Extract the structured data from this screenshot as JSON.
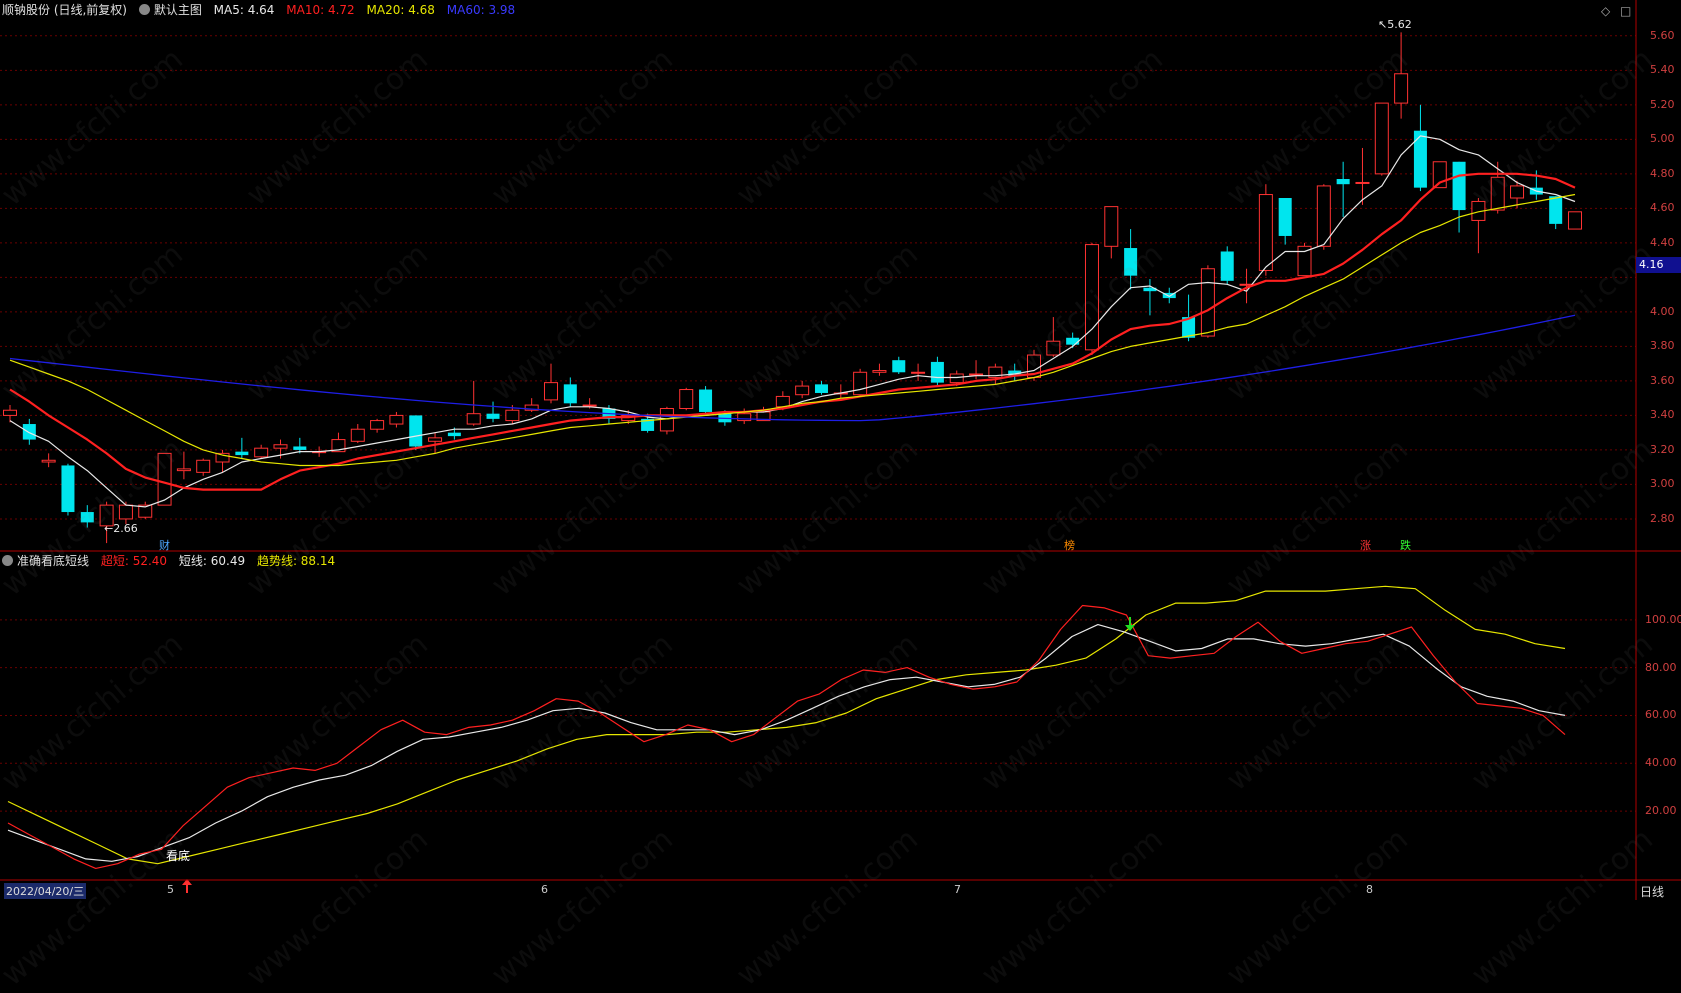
{
  "main_header": {
    "stock_title": "顺钠股份 (日线,前复权)",
    "chart_name": "默认主图",
    "ma5": "MA5: 4.64",
    "ma10": "MA10: 4.72",
    "ma20": "MA20: 4.68",
    "ma60": "MA60: 3.98"
  },
  "sub_header": {
    "indicator_name": "准确看底短线",
    "super_short": "超短: 52.40",
    "short_line": "短线: 60.49",
    "trend_line": "趋势线: 88.14"
  },
  "colors": {
    "up": "#ff3232",
    "down": "#00e5ee",
    "ma5": "#e8e8e8",
    "ma10": "#ff2020",
    "ma20": "#e6e600",
    "ma60": "#1e1ee6",
    "grid": "#6a0000",
    "axis": "#b00000",
    "price_flag": "#101090"
  },
  "price_axis": [
    "5.60",
    "5.40",
    "5.20",
    "5.00",
    "4.80",
    "4.60",
    "4.40",
    "4.00",
    "3.80",
    "3.60",
    "3.40",
    "3.20",
    "3.00",
    "2.80"
  ],
  "current_price": "4.16",
  "indicator_axis": [
    "100.00",
    "80.00",
    "60.00",
    "40.00",
    "20.00"
  ],
  "annotations": {
    "high_label": "5.62",
    "low_label": "←2.66",
    "high_arrow": "↖",
    "bottom_label": "看底"
  },
  "event_markers": [
    {
      "text": "财",
      "color": "#4da6ff"
    },
    {
      "text": "榜",
      "color": "#ff8c00"
    },
    {
      "text": "涨",
      "color": "#ff3232"
    },
    {
      "text": "跌",
      "color": "#33ff33"
    }
  ],
  "date_axis": [
    "2022/04/20/三",
    "5",
    "6",
    "7",
    "8"
  ],
  "period_label": "日线",
  "corner_icons": [
    "diamond-icon",
    "square-icon"
  ],
  "watermark": "www.cfchi.com",
  "chart_data": {
    "type": "candlestick",
    "price_range": [
      2.62,
      5.68
    ],
    "candles": [
      [
        3.4,
        3.43,
        3.46,
        3.36
      ],
      [
        3.35,
        3.26,
        3.38,
        3.23
      ],
      [
        3.13,
        3.14,
        3.18,
        3.1
      ],
      [
        3.11,
        2.84,
        3.12,
        2.82
      ],
      [
        2.84,
        2.78,
        2.88,
        2.75
      ],
      [
        2.76,
        2.88,
        2.9,
        2.66
      ],
      [
        2.8,
        2.88,
        2.9,
        2.77
      ],
      [
        2.81,
        2.88,
        2.9,
        2.8
      ],
      [
        2.88,
        3.18,
        3.18,
        2.88
      ],
      [
        3.08,
        3.09,
        3.19,
        3.03
      ],
      [
        3.07,
        3.14,
        3.15,
        3.05
      ],
      [
        3.13,
        3.18,
        3.2,
        3.07
      ],
      [
        3.19,
        3.17,
        3.27,
        3.15
      ],
      [
        3.16,
        3.21,
        3.23,
        3.15
      ],
      [
        3.21,
        3.23,
        3.26,
        3.15
      ],
      [
        3.22,
        3.2,
        3.27,
        3.18
      ],
      [
        3.19,
        3.19,
        3.22,
        3.16
      ],
      [
        3.19,
        3.26,
        3.3,
        3.19
      ],
      [
        3.25,
        3.32,
        3.35,
        3.24
      ],
      [
        3.32,
        3.37,
        3.38,
        3.3
      ],
      [
        3.35,
        3.4,
        3.42,
        3.33
      ],
      [
        3.4,
        3.22,
        3.4,
        3.2
      ],
      [
        3.25,
        3.27,
        3.3,
        3.18
      ],
      [
        3.3,
        3.28,
        3.33,
        3.26
      ],
      [
        3.35,
        3.41,
        3.6,
        3.34
      ],
      [
        3.41,
        3.38,
        3.48,
        3.36
      ],
      [
        3.37,
        3.43,
        3.46,
        3.35
      ],
      [
        3.43,
        3.46,
        3.5,
        3.42
      ],
      [
        3.49,
        3.59,
        3.7,
        3.47
      ],
      [
        3.58,
        3.47,
        3.62,
        3.45
      ],
      [
        3.46,
        3.46,
        3.5,
        3.44
      ],
      [
        3.44,
        3.38,
        3.46,
        3.35
      ],
      [
        3.37,
        3.4,
        3.43,
        3.35
      ],
      [
        3.38,
        3.31,
        3.41,
        3.3
      ],
      [
        3.31,
        3.44,
        3.45,
        3.29
      ],
      [
        3.44,
        3.55,
        3.56,
        3.43
      ],
      [
        3.55,
        3.42,
        3.57,
        3.41
      ],
      [
        3.41,
        3.36,
        3.43,
        3.34
      ],
      [
        3.37,
        3.41,
        3.44,
        3.35
      ],
      [
        3.37,
        3.42,
        3.45,
        3.37
      ],
      [
        3.45,
        3.51,
        3.54,
        3.43
      ],
      [
        3.52,
        3.57,
        3.6,
        3.5
      ],
      [
        3.58,
        3.53,
        3.6,
        3.52
      ],
      [
        3.53,
        3.53,
        3.58,
        3.5
      ],
      [
        3.52,
        3.65,
        3.67,
        3.51
      ],
      [
        3.65,
        3.66,
        3.7,
        3.63
      ],
      [
        3.72,
        3.65,
        3.74,
        3.64
      ],
      [
        3.65,
        3.65,
        3.7,
        3.6
      ],
      [
        3.71,
        3.59,
        3.74,
        3.57
      ],
      [
        3.59,
        3.64,
        3.66,
        3.57
      ],
      [
        3.64,
        3.64,
        3.72,
        3.61
      ],
      [
        3.62,
        3.68,
        3.7,
        3.58
      ],
      [
        3.66,
        3.63,
        3.7,
        3.6
      ],
      [
        3.62,
        3.75,
        3.78,
        3.6
      ],
      [
        3.75,
        3.83,
        3.97,
        3.74
      ],
      [
        3.85,
        3.81,
        3.88,
        3.79
      ],
      [
        3.78,
        4.39,
        4.4,
        3.75
      ],
      [
        4.38,
        4.61,
        4.61,
        4.31
      ],
      [
        4.37,
        4.21,
        4.48,
        4.13
      ],
      [
        4.14,
        4.12,
        4.19,
        3.98
      ],
      [
        4.11,
        4.08,
        4.14,
        4.05
      ],
      [
        3.97,
        3.85,
        4.1,
        3.83
      ],
      [
        3.86,
        4.25,
        4.27,
        3.85
      ],
      [
        4.35,
        4.18,
        4.38,
        4.16
      ],
      [
        4.16,
        4.16,
        4.25,
        4.05
      ],
      [
        4.24,
        4.68,
        4.74,
        4.21
      ],
      [
        4.66,
        4.44,
        4.66,
        4.39
      ],
      [
        4.21,
        4.38,
        4.4,
        4.21
      ],
      [
        4.38,
        4.73,
        4.74,
        4.36
      ],
      [
        4.77,
        4.74,
        4.87,
        4.55
      ],
      [
        4.75,
        4.75,
        4.95,
        4.62
      ],
      [
        4.8,
        5.21,
        5.21,
        4.79
      ],
      [
        5.21,
        5.38,
        5.62,
        5.12
      ],
      [
        5.05,
        4.72,
        5.2,
        4.7
      ],
      [
        4.72,
        4.87,
        4.87,
        4.72
      ],
      [
        4.87,
        4.59,
        4.87,
        4.46
      ],
      [
        4.53,
        4.64,
        4.66,
        4.34
      ],
      [
        4.59,
        4.78,
        4.87,
        4.57
      ],
      [
        4.66,
        4.73,
        4.76,
        4.6
      ],
      [
        4.72,
        4.68,
        4.82,
        4.65
      ],
      [
        4.67,
        4.51,
        4.67,
        4.48
      ],
      [
        4.48,
        4.58,
        4.58,
        4.48
      ]
    ],
    "ma5": [
      3.37,
      3.3,
      3.25,
      3.16,
      3.08,
      2.98,
      2.88,
      2.87,
      2.91,
      2.98,
      3.03,
      3.07,
      3.13,
      3.15,
      3.17,
      3.19,
      3.19,
      3.2,
      3.22,
      3.24,
      3.26,
      3.28,
      3.3,
      3.32,
      3.32,
      3.34,
      3.35,
      3.38,
      3.43,
      3.45,
      3.45,
      3.44,
      3.42,
      3.39,
      3.38,
      3.4,
      3.4,
      3.41,
      3.42,
      3.42,
      3.44,
      3.48,
      3.51,
      3.53,
      3.55,
      3.58,
      3.61,
      3.63,
      3.62,
      3.62,
      3.63,
      3.63,
      3.64,
      3.66,
      3.73,
      3.8,
      3.9,
      4.03,
      4.14,
      4.15,
      4.09,
      4.16,
      4.17,
      4.16,
      4.12,
      4.26,
      4.35,
      4.35,
      4.39,
      4.54,
      4.65,
      4.73,
      4.91,
      5.02,
      5.0,
      4.94,
      4.91,
      4.83,
      4.75,
      4.7,
      4.68,
      4.64
    ],
    "ma10": [
      3.55,
      3.48,
      3.4,
      3.33,
      3.26,
      3.18,
      3.09,
      3.04,
      3.01,
      2.98,
      2.97,
      2.97,
      2.97,
      2.97,
      3.03,
      3.08,
      3.1,
      3.12,
      3.15,
      3.17,
      3.19,
      3.21,
      3.23,
      3.25,
      3.27,
      3.29,
      3.31,
      3.33,
      3.35,
      3.37,
      3.38,
      3.39,
      3.39,
      3.4,
      3.4,
      3.4,
      3.41,
      3.42,
      3.42,
      3.43,
      3.44,
      3.46,
      3.48,
      3.49,
      3.51,
      3.53,
      3.55,
      3.56,
      3.57,
      3.58,
      3.6,
      3.61,
      3.63,
      3.64,
      3.67,
      3.7,
      3.76,
      3.84,
      3.9,
      3.92,
      3.93,
      3.96,
      4.01,
      4.08,
      4.14,
      4.18,
      4.18,
      4.2,
      4.22,
      4.28,
      4.36,
      4.45,
      4.53,
      4.65,
      4.75,
      4.79,
      4.8,
      4.8,
      4.8,
      4.79,
      4.77,
      4.72
    ],
    "ma20": [
      3.72,
      3.68,
      3.64,
      3.6,
      3.55,
      3.49,
      3.43,
      3.37,
      3.31,
      3.25,
      3.2,
      3.17,
      3.15,
      3.13,
      3.12,
      3.11,
      3.11,
      3.11,
      3.12,
      3.13,
      3.14,
      3.16,
      3.18,
      3.21,
      3.23,
      3.25,
      3.27,
      3.29,
      3.31,
      3.33,
      3.34,
      3.35,
      3.36,
      3.37,
      3.38,
      3.39,
      3.4,
      3.41,
      3.42,
      3.43,
      3.45,
      3.47,
      3.48,
      3.5,
      3.51,
      3.52,
      3.53,
      3.54,
      3.55,
      3.56,
      3.57,
      3.58,
      3.6,
      3.62,
      3.65,
      3.69,
      3.73,
      3.77,
      3.8,
      3.82,
      3.84,
      3.86,
      3.88,
      3.91,
      3.93,
      3.98,
      4.03,
      4.09,
      4.14,
      4.19,
      4.26,
      4.33,
      4.4,
      4.46,
      4.5,
      4.55,
      4.58,
      4.6,
      4.62,
      4.64,
      4.66,
      4.68
    ],
    "ma60_start": 3.73,
    "ma60_low": 3.37,
    "ma60_end": 3.98,
    "indicator": {
      "range": [
        -8,
        120
      ],
      "super_short": [
        15,
        10,
        5,
        0,
        -4,
        -2,
        2,
        4,
        14,
        22,
        30,
        34,
        36,
        38,
        37,
        40,
        47,
        54,
        58,
        53,
        52,
        55,
        56,
        58,
        62,
        67,
        66,
        61,
        55,
        49,
        52,
        56,
        54,
        49,
        52,
        59,
        66,
        69,
        75,
        79,
        78,
        80,
        76,
        73,
        71,
        72,
        74,
        83,
        96,
        106,
        105,
        102,
        85,
        84,
        85,
        86,
        93,
        99,
        91,
        86,
        88,
        90,
        91,
        94,
        97,
        85,
        74,
        65,
        64,
        63,
        60,
        52
      ],
      "short_line": [
        12,
        8,
        4,
        0,
        -1,
        1,
        5,
        9,
        15,
        20,
        26,
        30,
        33,
        35,
        39,
        45,
        50,
        51,
        53,
        55,
        58,
        62,
        63,
        61,
        57,
        54,
        54,
        54,
        52,
        54,
        58,
        63,
        68,
        72,
        75,
        76,
        74,
        72,
        73,
        76,
        84,
        93,
        98,
        95,
        91,
        87,
        88,
        92,
        92,
        90,
        89,
        90,
        92,
        94,
        89,
        80,
        72,
        68,
        66,
        62,
        60
      ],
      "trend_line": [
        24,
        18,
        12,
        6,
        0,
        -2,
        1,
        4,
        7,
        10,
        13,
        16,
        19,
        23,
        28,
        33,
        37,
        41,
        46,
        50,
        52,
        52,
        52,
        53,
        53,
        54,
        55,
        57,
        61,
        67,
        71,
        75,
        77,
        78,
        79,
        81,
        84,
        92,
        102,
        107,
        107,
        108,
        112,
        112,
        112,
        113,
        114,
        113,
        104,
        96,
        94,
        90,
        88
      ]
    }
  }
}
